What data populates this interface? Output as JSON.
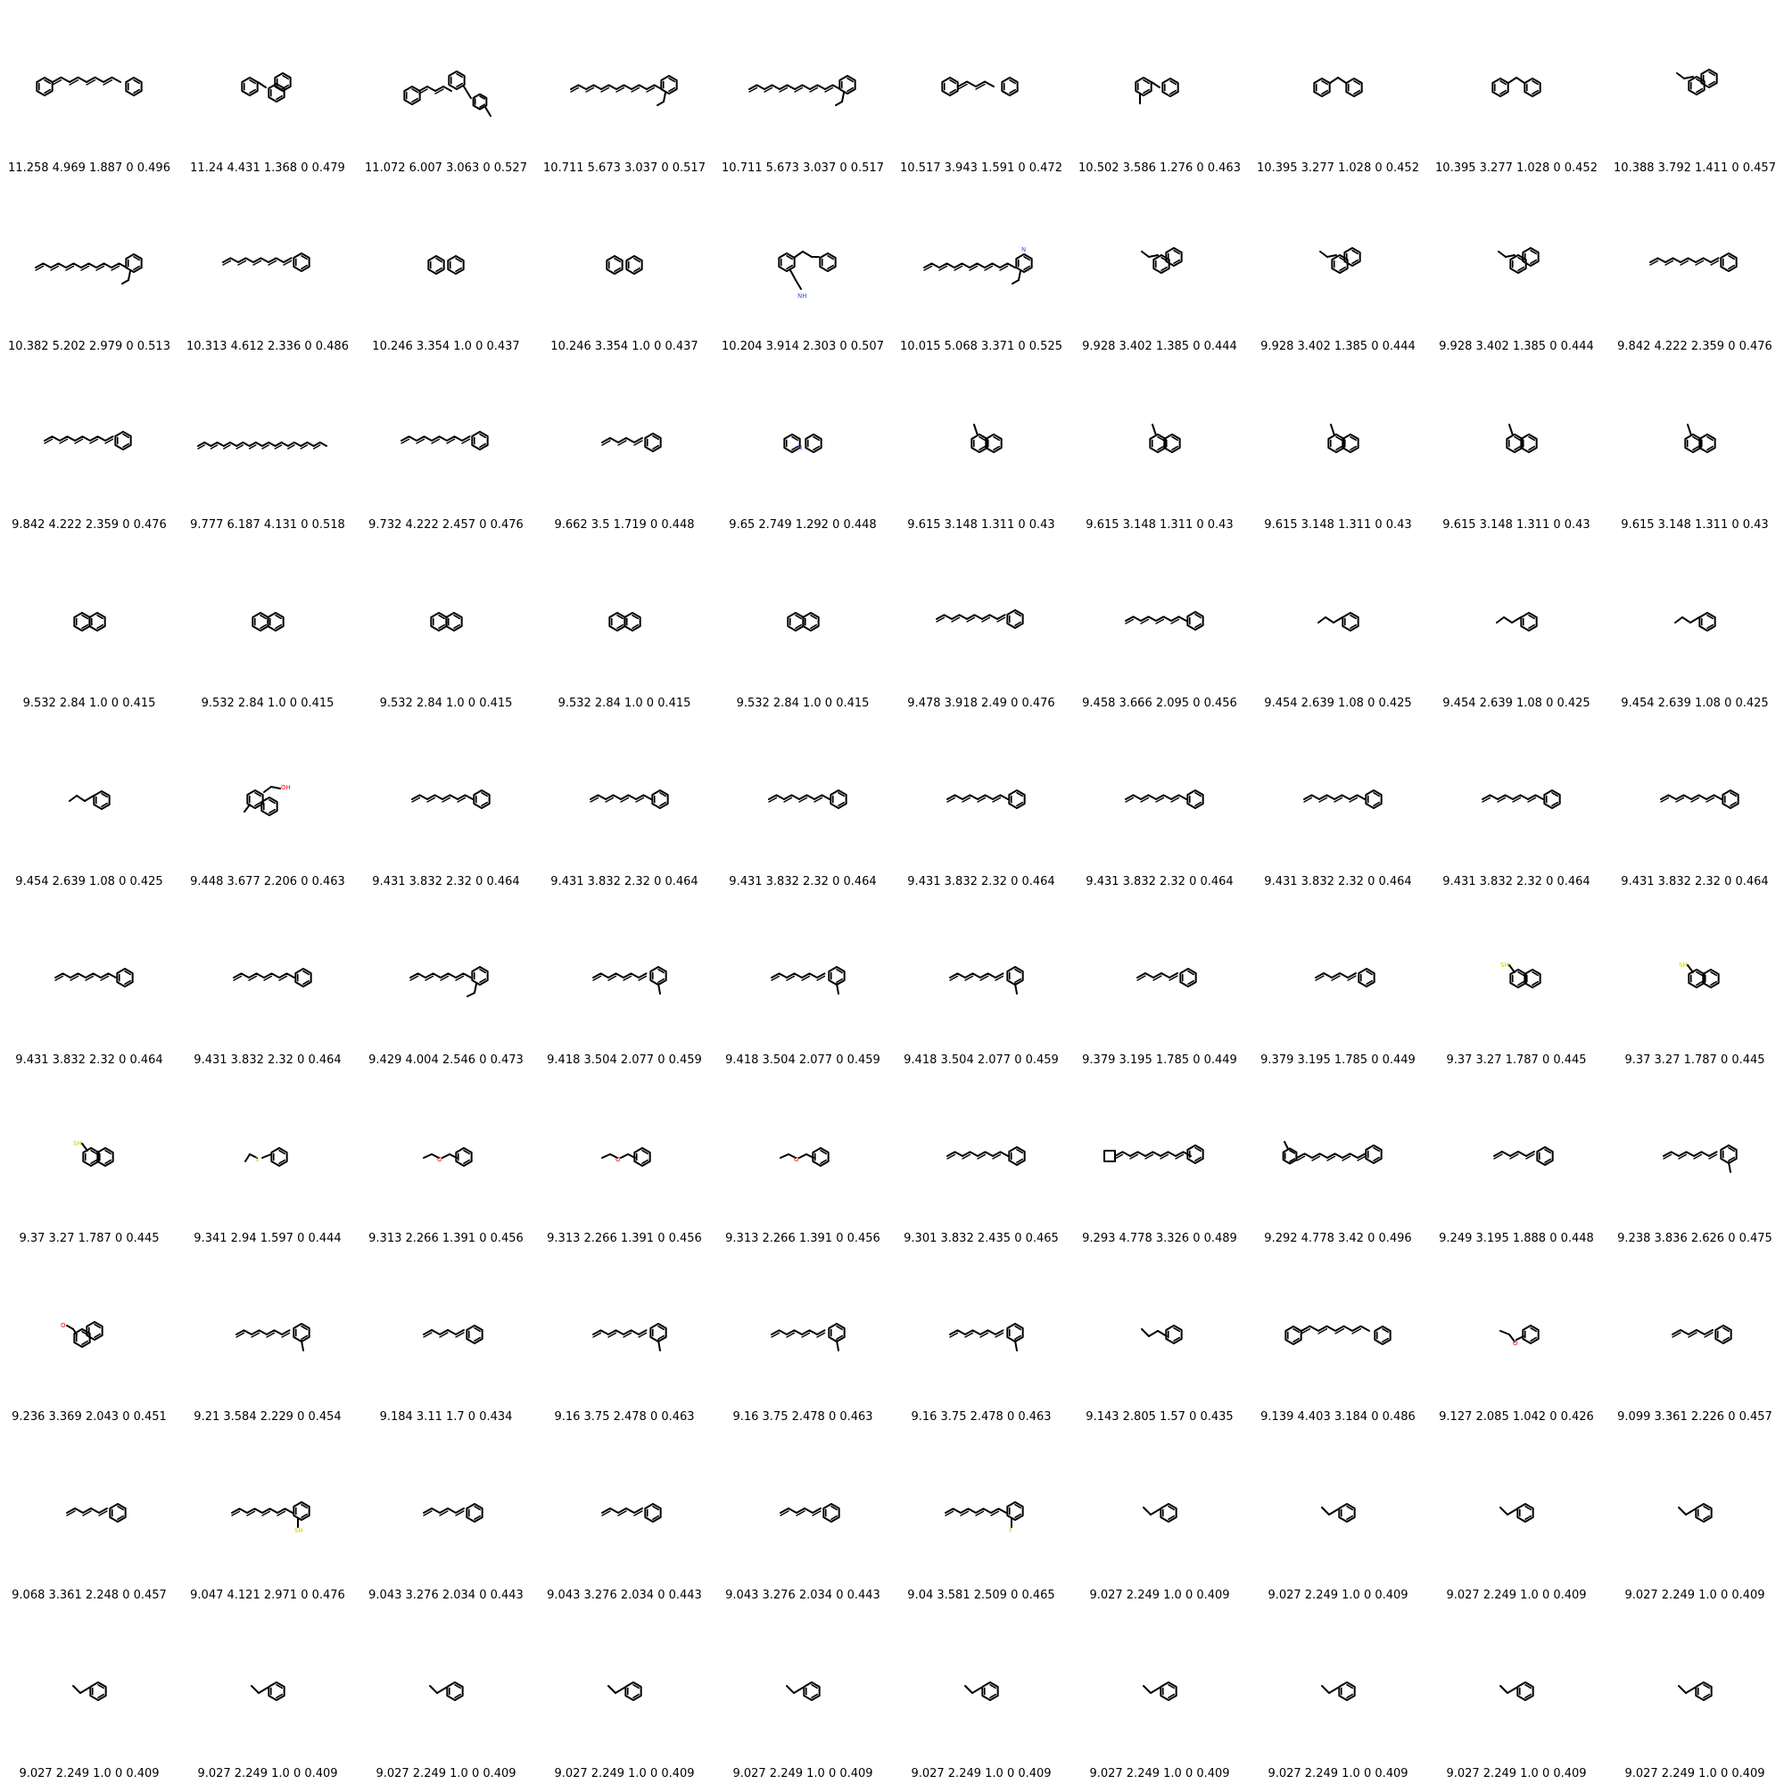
{
  "molecules": [
    {
      "shape": "diarylchain",
      "caption": "11.258 4.969 1.887 0 0.496"
    },
    {
      "shape": "benzylnaph",
      "caption": "11.24 4.431 1.368 0 0.479"
    },
    {
      "shape": "styrylpyrrole",
      "caption": "11.072 6.007 3.063 0 0.527"
    },
    {
      "shape": "longchain_ethyl",
      "caption": "10.711 5.673 3.037 0 0.517"
    },
    {
      "shape": "longchain_ethyl",
      "caption": "10.711 5.673 3.037 0 0.517"
    },
    {
      "shape": "diphenylpropane",
      "caption": "10.517 3.943 1.591 0 0.472"
    },
    {
      "shape": "methyldiphenylmethane",
      "caption": "10.502 3.586 1.276 0 0.463"
    },
    {
      "shape": "diphenylmethane",
      "caption": "10.395 3.277 1.028 0 0.452"
    },
    {
      "shape": "diphenylmethane",
      "caption": "10.395 3.277 1.028 0 0.452"
    },
    {
      "shape": "ethylnaph",
      "caption": "10.388 3.792 1.411 0 0.457"
    },
    {
      "shape": "longchain_ethyl",
      "caption": "10.382 5.202 2.979 0 0.513"
    },
    {
      "shape": "chain_phenyl_long",
      "caption": "10.313 4.612 2.336 0 0.486"
    },
    {
      "shape": "biphenyl",
      "caption": "10.246 3.354 1.0 0 0.437"
    },
    {
      "shape": "biphenyl",
      "caption": "10.246 3.354 1.0 0 0.437"
    },
    {
      "shape": "stilbene_amine",
      "caption": "10.204 3.914 2.303 0 0.507"
    },
    {
      "shape": "longchain_pyridine",
      "caption": "10.015 5.068 3.371 0 0.525"
    },
    {
      "shape": "ethylnaph",
      "caption": "9.928 3.402 1.385 0 0.444"
    },
    {
      "shape": "ethylnaph",
      "caption": "9.928 3.402 1.385 0 0.444"
    },
    {
      "shape": "ethylnaph",
      "caption": "9.928 3.402 1.385 0 0.444"
    },
    {
      "shape": "chain_phenyl_long",
      "caption": "9.842 4.222 2.359 0 0.476"
    },
    {
      "shape": "chain_phenyl_long",
      "caption": "9.842 4.222 2.359 0 0.476"
    },
    {
      "shape": "verylongchain",
      "caption": "9.777 6.187 4.131 0 0.518"
    },
    {
      "shape": "chain_phenyl_long",
      "caption": "9.732 4.222 2.457 0 0.476"
    },
    {
      "shape": "chain_phenyl_short",
      "caption": "9.662 3.5 1.719 0 0.448"
    },
    {
      "shape": "phenylpyridine",
      "caption": "9.65 2.749 1.292 0 0.448"
    },
    {
      "shape": "methylnaph",
      "caption": "9.615 3.148 1.311 0 0.43"
    },
    {
      "shape": "methylnaph",
      "caption": "9.615 3.148 1.311 0 0.43"
    },
    {
      "shape": "methylnaph",
      "caption": "9.615 3.148 1.311 0 0.43"
    },
    {
      "shape": "methylnaph",
      "caption": "9.615 3.148 1.311 0 0.43"
    },
    {
      "shape": "methylnaph",
      "caption": "9.615 3.148 1.311 0 0.43"
    },
    {
      "shape": "naphthalene",
      "caption": "9.532 2.84 1.0 0 0.415"
    },
    {
      "shape": "naphthalene",
      "caption": "9.532 2.84 1.0 0 0.415"
    },
    {
      "shape": "naphthalene",
      "caption": "9.532 2.84 1.0 0 0.415"
    },
    {
      "shape": "naphthalene",
      "caption": "9.532 2.84 1.0 0 0.415"
    },
    {
      "shape": "naphthalene",
      "caption": "9.532 2.84 1.0 0 0.415"
    },
    {
      "shape": "chain_phenyl_long",
      "caption": "9.478 3.918 2.49 0 0.476"
    },
    {
      "shape": "chain_phenyl_mid",
      "caption": "9.458 3.666 2.095 0 0.456"
    },
    {
      "shape": "propylbenzene",
      "caption": "9.454 2.639 1.08 0 0.425"
    },
    {
      "shape": "propylbenzene",
      "caption": "9.454 2.639 1.08 0 0.425"
    },
    {
      "shape": "propylbenzene",
      "caption": "9.454 2.639 1.08 0 0.425"
    },
    {
      "shape": "propylbenzene",
      "caption": "9.454 2.639 1.08 0 0.425"
    },
    {
      "shape": "naph_enol",
      "caption": "9.448 3.677 2.206 0 0.463"
    },
    {
      "shape": "chain_phenyl_mid",
      "caption": "9.431 3.832 2.32 0 0.464"
    },
    {
      "shape": "chain_phenyl_mid",
      "caption": "9.431 3.832 2.32 0 0.464"
    },
    {
      "shape": "chain_phenyl_mid",
      "caption": "9.431 3.832 2.32 0 0.464"
    },
    {
      "shape": "chain_phenyl_mid",
      "caption": "9.431 3.832 2.32 0 0.464"
    },
    {
      "shape": "chain_phenyl_mid",
      "caption": "9.431 3.832 2.32 0 0.464"
    },
    {
      "shape": "chain_phenyl_mid",
      "caption": "9.431 3.832 2.32 0 0.464"
    },
    {
      "shape": "chain_phenyl_mid",
      "caption": "9.431 3.832 2.32 0 0.464"
    },
    {
      "shape": "chain_phenyl_mid",
      "caption": "9.431 3.832 2.32 0 0.464"
    },
    {
      "shape": "chain_phenyl_mid",
      "caption": "9.431 3.832 2.32 0 0.464"
    },
    {
      "shape": "chain_phenyl_mid",
      "caption": "9.431 3.832 2.32 0 0.464"
    },
    {
      "shape": "chain_ethylphenyl",
      "caption": "9.429 4.004 2.546 0 0.473"
    },
    {
      "shape": "chain_methylphenyl",
      "caption": "9.418 3.504 2.077 0 0.459"
    },
    {
      "shape": "chain_methylphenyl",
      "caption": "9.418 3.504 2.077 0 0.459"
    },
    {
      "shape": "chain_methylphenyl",
      "caption": "9.418 3.504 2.077 0 0.459"
    },
    {
      "shape": "chain_phenyl_short",
      "caption": "9.379 3.195 1.785 0 0.449"
    },
    {
      "shape": "chain_phenyl_short",
      "caption": "9.379 3.195 1.785 0 0.449"
    },
    {
      "shape": "naph_thiol",
      "caption": "9.37 3.27 1.787 0 0.445"
    },
    {
      "shape": "naph_thiol",
      "caption": "9.37 3.27 1.787 0 0.445"
    },
    {
      "shape": "naph_thiol",
      "caption": "9.37 3.27 1.787 0 0.445"
    },
    {
      "shape": "thioether_benzyl",
      "caption": "9.341 2.94 1.597 0 0.444"
    },
    {
      "shape": "ether_phenyl",
      "caption": "9.313 2.266 1.391 0 0.456"
    },
    {
      "shape": "ether_phenyl",
      "caption": "9.313 2.266 1.391 0 0.456"
    },
    {
      "shape": "ether_phenyl",
      "caption": "9.313 2.266 1.391 0 0.456"
    },
    {
      "shape": "chain_phenyl_mid",
      "caption": "9.301 3.832 2.435 0 0.465"
    },
    {
      "shape": "cyclobutene_chain",
      "caption": "9.293 4.778 3.326 0 0.489"
    },
    {
      "shape": "pyrrole_chain",
      "caption": "9.292 4.778 3.42 0 0.496"
    },
    {
      "shape": "chain_phenyl_short",
      "caption": "9.249 3.195 1.888 0 0.448"
    },
    {
      "shape": "chain_methylphenyl",
      "caption": "9.238 3.836 2.626 0 0.475"
    },
    {
      "shape": "naph_enol2",
      "caption": "9.236 3.369 2.043 0 0.451"
    },
    {
      "shape": "chain_methylphenyl",
      "caption": "9.21 3.584 2.229 0 0.454"
    },
    {
      "shape": "chain_phenyl_short",
      "caption": "9.184 3.11 1.7 0 0.434"
    },
    {
      "shape": "chain_methylphenyl",
      "caption": "9.16 3.75 2.478 0 0.463"
    },
    {
      "shape": "chain_methylphenyl",
      "caption": "9.16 3.75 2.478 0 0.463"
    },
    {
      "shape": "chain_methylphenyl",
      "caption": "9.16 3.75 2.478 0 0.463"
    },
    {
      "shape": "allylbenzene",
      "caption": "9.143 2.805 1.57 0 0.435"
    },
    {
      "shape": "diarylchain",
      "caption": "9.139 4.403 3.184 0 0.486"
    },
    {
      "shape": "ethoxybenzene",
      "caption": "9.127 2.085 1.042 0 0.426"
    },
    {
      "shape": "chain_phenyl_short",
      "caption": "9.099 3.361 2.226 0 0.457"
    },
    {
      "shape": "chain_phenyl_short",
      "caption": "9.068 3.361 2.248 0 0.457"
    },
    {
      "shape": "chain_thiophenyl",
      "caption": "9.047 4.121 2.971 0 0.476"
    },
    {
      "shape": "chain_phenyl_short",
      "caption": "9.043 3.276 2.034 0 0.443"
    },
    {
      "shape": "chain_phenyl_short",
      "caption": "9.043 3.276 2.034 0 0.443"
    },
    {
      "shape": "chain_phenyl_short",
      "caption": "9.043 3.276 2.034 0 0.443"
    },
    {
      "shape": "chain_fluorophenyl",
      "caption": "9.04 3.581 2.509 0 0.465"
    },
    {
      "shape": "ethylbenzene",
      "caption": "9.027 2.249 1.0 0 0.409"
    },
    {
      "shape": "ethylbenzene",
      "caption": "9.027 2.249 1.0 0 0.409"
    },
    {
      "shape": "ethylbenzene",
      "caption": "9.027 2.249 1.0 0 0.409"
    },
    {
      "shape": "ethylbenzene",
      "caption": "9.027 2.249 1.0 0 0.409"
    },
    {
      "shape": "ethylbenzene",
      "caption": "9.027 2.249 1.0 0 0.409"
    },
    {
      "shape": "ethylbenzene",
      "caption": "9.027 2.249 1.0 0 0.409"
    },
    {
      "shape": "ethylbenzene",
      "caption": "9.027 2.249 1.0 0 0.409"
    },
    {
      "shape": "ethylbenzene",
      "caption": "9.027 2.249 1.0 0 0.409"
    },
    {
      "shape": "ethylbenzene",
      "caption": "9.027 2.249 1.0 0 0.409"
    },
    {
      "shape": "ethylbenzene",
      "caption": "9.027 2.249 1.0 0 0.409"
    },
    {
      "shape": "ethylbenzene",
      "caption": "9.027 2.249 1.0 0 0.409"
    },
    {
      "shape": "ethylbenzene",
      "caption": "9.027 2.249 1.0 0 0.409"
    },
    {
      "shape": "ethylbenzene",
      "caption": "9.027 2.249 1.0 0 0.409"
    },
    {
      "shape": "ethylbenzene",
      "caption": "9.027 2.249 1.0 0 0.409"
    }
  ],
  "colors": {
    "bond": "#000000",
    "oxygen": "#ff0000",
    "nitrogen": "#3050f8",
    "sulfur": "#cccc00",
    "fluorine": "#90e050"
  }
}
